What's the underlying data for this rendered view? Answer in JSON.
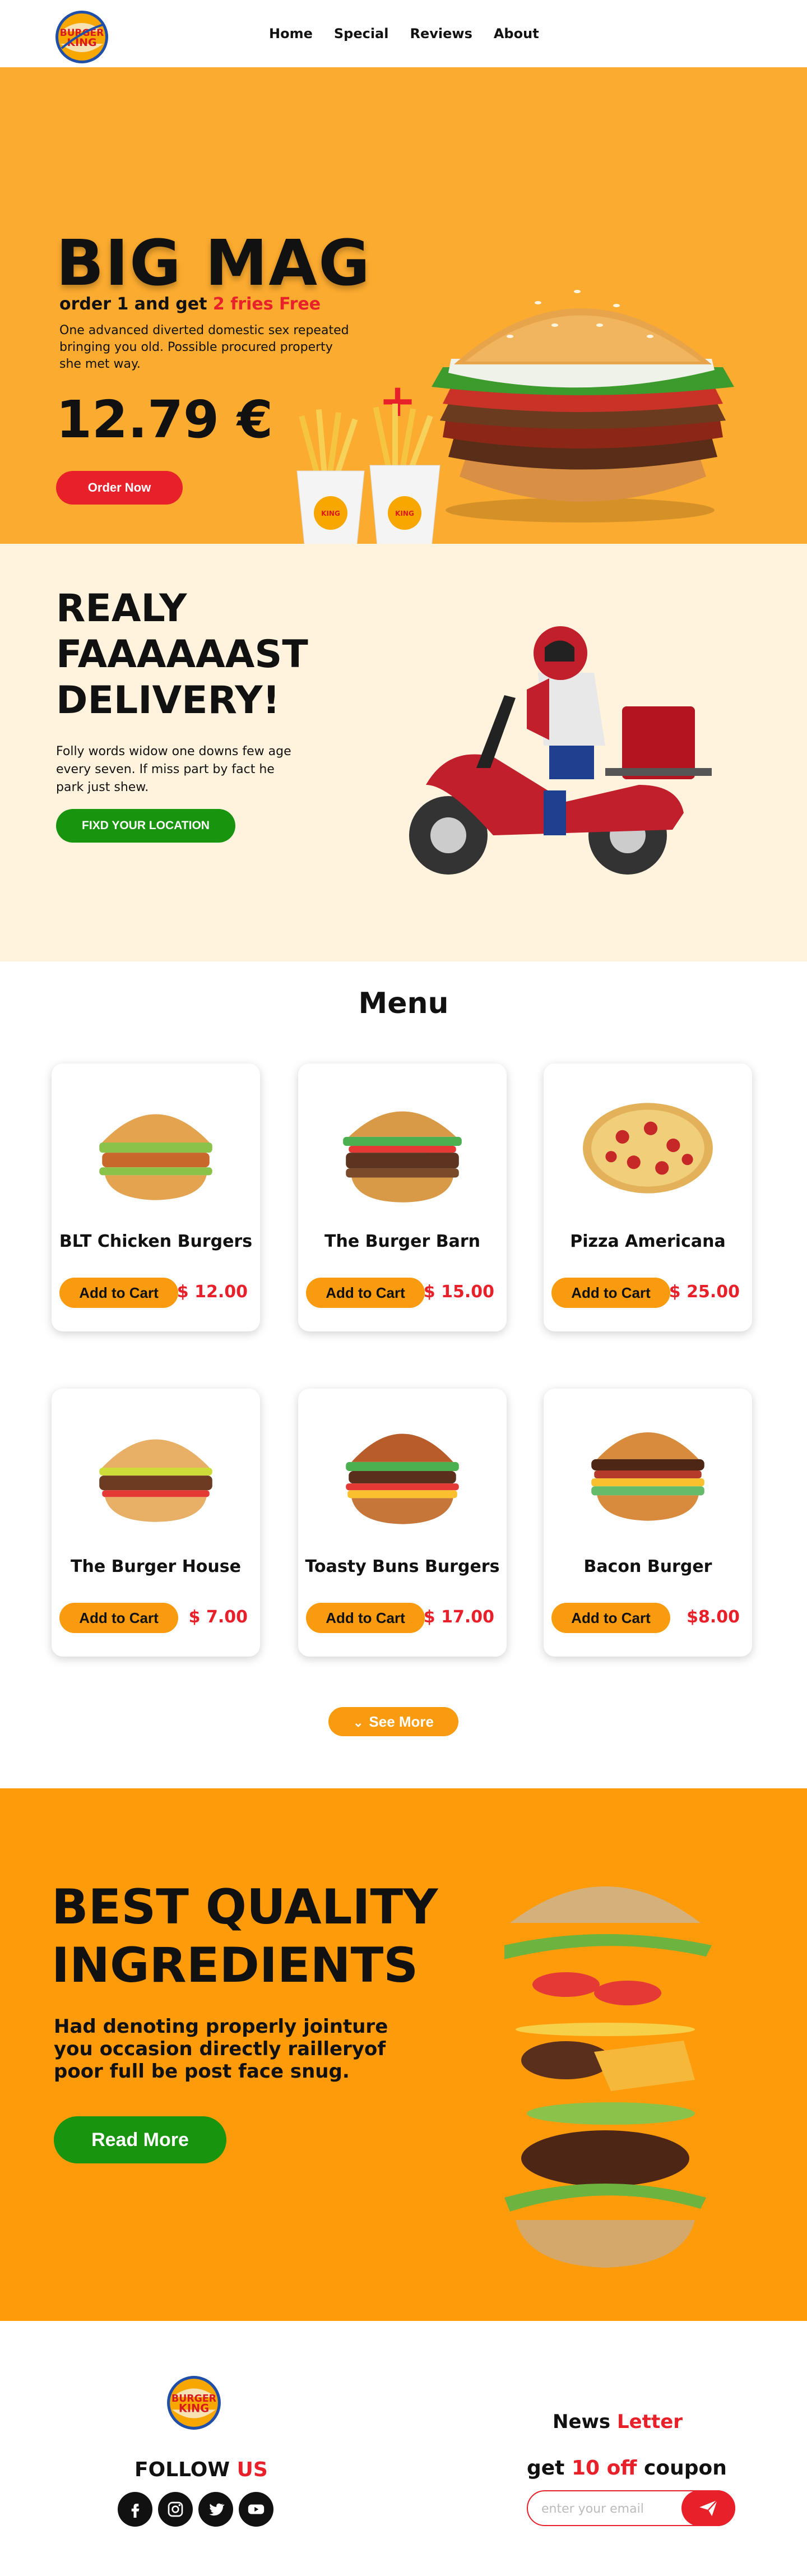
{
  "nav": {
    "links": [
      "Home",
      "Special",
      "Reviews",
      "About"
    ]
  },
  "hero": {
    "title": "BIG MAG",
    "subtitle_prefix": "order 1 and get ",
    "subtitle_highlight": "2 fries Free",
    "description": "One advanced diverted domestic sex repeated bringing you old. Possible procured property she met way.",
    "price": "12.79 €",
    "order_button": "Order Now"
  },
  "delivery": {
    "title": "REALY FAAAAAAST DELIVERY!",
    "description": "Folly words widow one downs few age every seven. If miss part by fact he park just shew.",
    "location_button": "FIXD YOUR LOCATION"
  },
  "menu": {
    "title": "Menu",
    "add_label": "Add to Cart",
    "items": [
      {
        "name": "BLT Chicken Burgers",
        "price": "$ 12.00"
      },
      {
        "name": "The Burger Barn",
        "price": "$ 15.00"
      },
      {
        "name": "Pizza Americana",
        "price": "$ 25.00"
      },
      {
        "name": "The Burger House",
        "price": "$ 7.00"
      },
      {
        "name": "Toasty Buns Burgers",
        "price": "$ 17.00"
      },
      {
        "name": "Bacon Burger",
        "price": "$8.00"
      }
    ],
    "see_more": "See More"
  },
  "quality": {
    "title": "BEST QUALITY INGREDIENTS",
    "description": "Had denoting properly jointure you occasion directly railleryof poor full be post face snug.",
    "read_more": "Read More"
  },
  "footer": {
    "follow_prefix": "FOLLOW ",
    "follow_highlight": "US",
    "newsletter_prefix": "News ",
    "newsletter_highlight": "Letter",
    "coupon_prefix": "get ",
    "coupon_highlight": "10 off",
    "coupon_suffix": " coupon",
    "email_placeholder": "enter your email",
    "socials": [
      "facebook-icon",
      "instagram-icon",
      "twitter-icon",
      "youtube-icon"
    ]
  },
  "colors": {
    "hero_bg": "#fbab2f",
    "delivery_bg": "#fff3dd",
    "quality_bg": "#fd9b0a",
    "accent_red": "#e8202a",
    "accent_green": "#18940e",
    "button_orange": "#f89b0f"
  }
}
